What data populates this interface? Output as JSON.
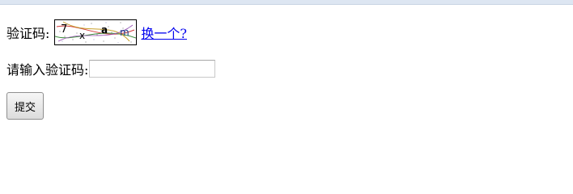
{
  "form": {
    "captcha_label": "验证码:",
    "captcha_text": [
      "7",
      "x",
      "a",
      "m"
    ],
    "refresh_link": "换一个?",
    "input_label": "请输入验证码:",
    "input_value": "",
    "input_placeholder": "",
    "submit_label": "提交"
  },
  "colors": {
    "link": "#0000ee",
    "captcha_noise": [
      "#d23c3c",
      "#3c8c3c",
      "#3c5ad2",
      "#c8a02a",
      "#9a50b4"
    ]
  }
}
